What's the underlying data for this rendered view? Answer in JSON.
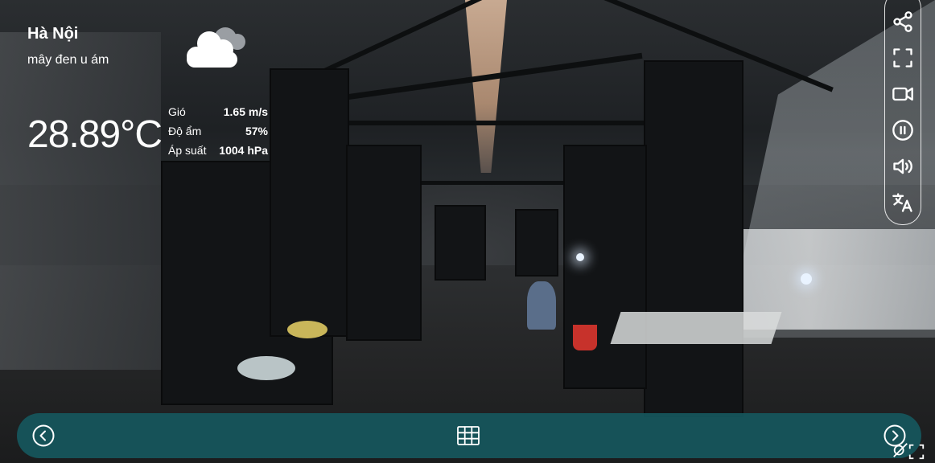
{
  "weather": {
    "city": "Hà Nội",
    "description": "mây đen u ám",
    "icon": "cloud-icon",
    "temperature": "28.89°C",
    "stats": [
      {
        "label": "Gió",
        "value": "1.65 m/s"
      },
      {
        "label": "Độ ẩm",
        "value": "57%"
      },
      {
        "label": "Áp suất",
        "value": "1004 hPa"
      }
    ]
  },
  "toolbar": {
    "items": [
      {
        "icon": "share-icon"
      },
      {
        "icon": "fullscreen-icon"
      },
      {
        "icon": "video-camera-icon"
      },
      {
        "icon": "pause-icon"
      },
      {
        "icon": "volume-icon"
      },
      {
        "icon": "translate-icon"
      }
    ]
  },
  "bottom_bar": {
    "background": "#16565c",
    "left_icon": "chevron-left-icon",
    "center_icon": "grid-icon",
    "right_icon": "chevron-right-icon"
  },
  "colors": {
    "accent": "#16565c",
    "text": "#ffffff"
  }
}
